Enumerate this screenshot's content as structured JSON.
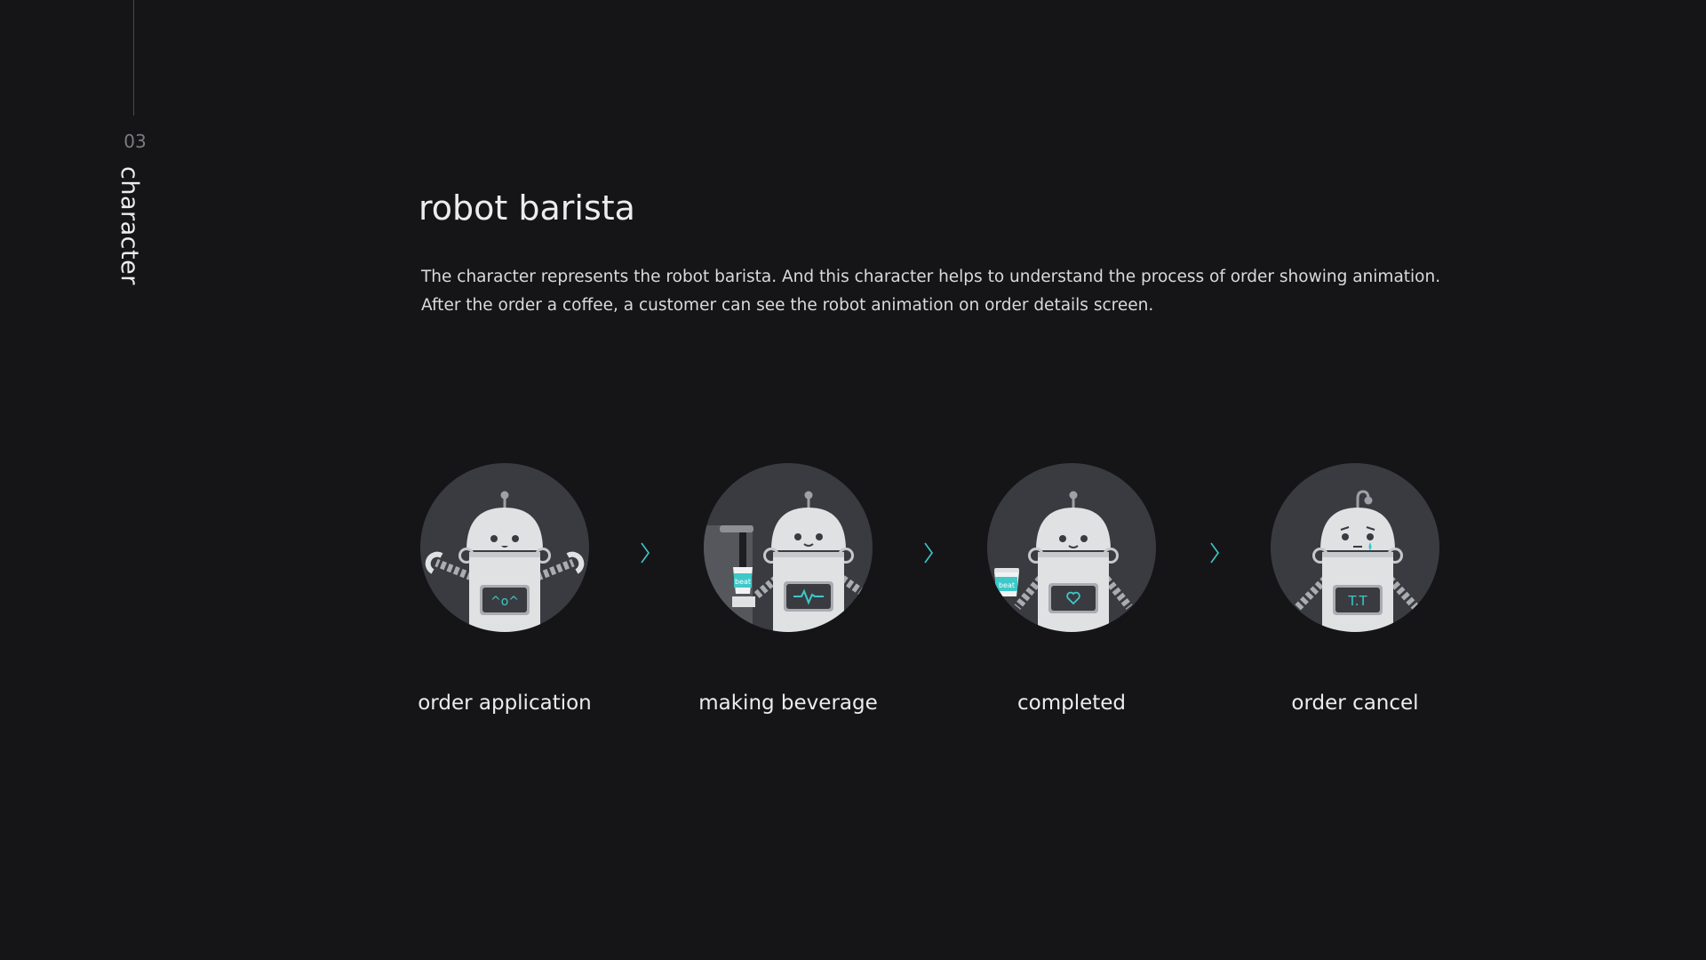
{
  "section": {
    "number": "03",
    "label": "character"
  },
  "title": "robot barista",
  "description": [
    "The character represents the robot barista. And this character helps to understand the process of order showing animation.",
    "After the order a coffee, a customer can see the robot animation on order details screen."
  ],
  "steps": [
    {
      "label": "order application",
      "screen": "^o^",
      "icon": "robot-happy-icon"
    },
    {
      "label": "making beverage",
      "screen": "",
      "icon": "robot-making-icon",
      "cup_text": "beat"
    },
    {
      "label": "completed",
      "screen": "",
      "icon": "robot-completed-icon",
      "cup_text": "beat"
    },
    {
      "label": "order cancel",
      "screen": "T.T",
      "icon": "robot-sad-icon"
    }
  ],
  "colors": {
    "background": "#151517",
    "circle": "#3a3b40",
    "accent": "#3ec8c8",
    "robot": "#dfe1e3"
  }
}
